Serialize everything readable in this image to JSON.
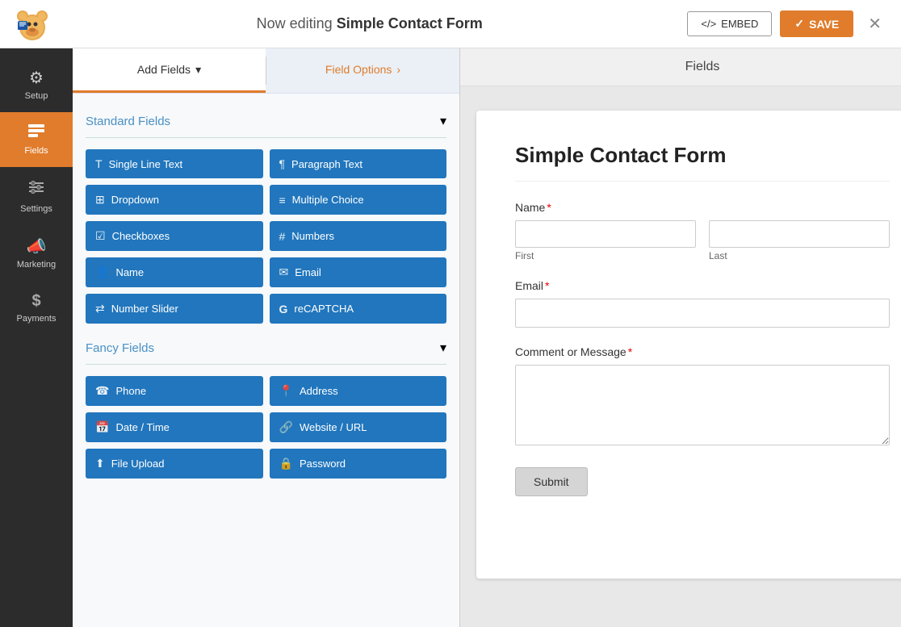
{
  "header": {
    "editing_prefix": "Now editing",
    "form_name": "Simple Contact Form",
    "embed_label": "EMBED",
    "save_label": "SAVE",
    "close_icon": "✕"
  },
  "sidebar": {
    "items": [
      {
        "id": "setup",
        "label": "Setup",
        "icon": "⚙"
      },
      {
        "id": "fields",
        "label": "Fields",
        "icon": "☰",
        "active": true
      },
      {
        "id": "settings",
        "label": "Settings",
        "icon": "⚡"
      },
      {
        "id": "marketing",
        "label": "Marketing",
        "icon": "📣"
      },
      {
        "id": "payments",
        "label": "Payments",
        "icon": "$"
      }
    ]
  },
  "fields_panel": {
    "tab_add": "Add Fields",
    "tab_options": "Field Options",
    "section_standard": "Standard Fields",
    "section_fancy": "Fancy Fields",
    "standard_fields": [
      {
        "id": "single-line-text",
        "label": "Single Line Text",
        "icon": "T"
      },
      {
        "id": "paragraph-text",
        "label": "Paragraph Text",
        "icon": "¶"
      },
      {
        "id": "dropdown",
        "label": "Dropdown",
        "icon": "⊞"
      },
      {
        "id": "multiple-choice",
        "label": "Multiple Choice",
        "icon": "≡"
      },
      {
        "id": "checkboxes",
        "label": "Checkboxes",
        "icon": "☑"
      },
      {
        "id": "numbers",
        "label": "Numbers",
        "icon": "#"
      },
      {
        "id": "name",
        "label": "Name",
        "icon": "👤"
      },
      {
        "id": "email",
        "label": "Email",
        "icon": "✉"
      },
      {
        "id": "number-slider",
        "label": "Number Slider",
        "icon": "⇄"
      },
      {
        "id": "recaptcha",
        "label": "reCAPTCHA",
        "icon": "G"
      }
    ],
    "fancy_fields": [
      {
        "id": "phone",
        "label": "Phone",
        "icon": "☎"
      },
      {
        "id": "address",
        "label": "Address",
        "icon": "📍"
      },
      {
        "id": "date-time",
        "label": "Date / Time",
        "icon": "📅"
      },
      {
        "id": "website-url",
        "label": "Website / URL",
        "icon": "🔗"
      },
      {
        "id": "file-upload",
        "label": "File Upload",
        "icon": "⬆"
      },
      {
        "id": "password",
        "label": "Password",
        "icon": "🔒"
      }
    ]
  },
  "center_panel": {
    "title": "Fields"
  },
  "form_preview": {
    "title": "Simple Contact Form",
    "fields": [
      {
        "id": "name",
        "label": "Name",
        "required": true,
        "type": "name",
        "sub_fields": [
          "First",
          "Last"
        ]
      },
      {
        "id": "email",
        "label": "Email",
        "required": true,
        "type": "text"
      },
      {
        "id": "comment",
        "label": "Comment or Message",
        "required": true,
        "type": "textarea"
      }
    ],
    "submit_label": "Submit"
  }
}
